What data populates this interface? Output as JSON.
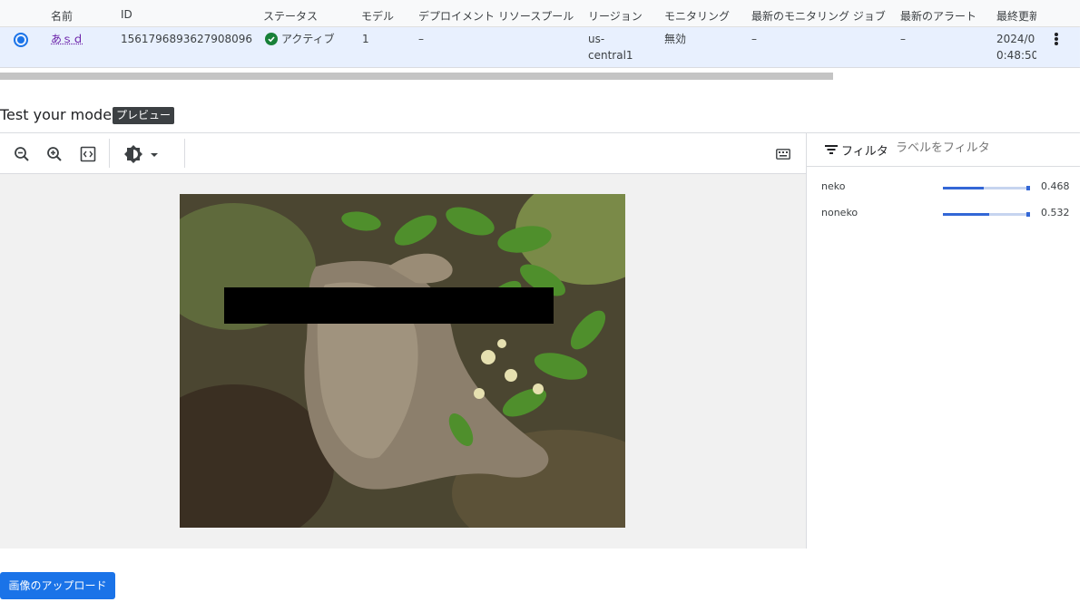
{
  "table": {
    "headers": [
      "名前",
      "ID",
      "ステータス",
      "モデル",
      "デプロイメント リソースプール",
      "リージョン",
      "モニタリング",
      "最新のモニタリング ジョブ",
      "最新のアラート",
      "最終更新"
    ],
    "row": {
      "name": "あｓｄ",
      "id": "1561796893627908096",
      "status": "アクティブ",
      "models": "1",
      "resource_pool": "–",
      "region_line1": "us-",
      "region_line2": "central1",
      "monitoring": "無効",
      "latest_monitoring_job": "–",
      "latest_alert": "–",
      "updated_line1": "2024/0",
      "updated_line2": "0:48:50"
    }
  },
  "test": {
    "title": "Test your model",
    "badge": "プレビュー"
  },
  "toolbar": {
    "icons": [
      "zoom-out-icon",
      "zoom-in-icon",
      "code-icon",
      "brightness-icon",
      "keyboard-icon"
    ]
  },
  "filter": {
    "label": "フィルタ",
    "placeholder": "ラベルをフィルタ"
  },
  "predictions": [
    {
      "label": "neko",
      "score": "0.468",
      "fraction": 0.468
    },
    {
      "label": "noneko",
      "score": "0.532",
      "fraction": 0.532
    }
  ],
  "upload_button": "画像のアップロード",
  "colors": {
    "accent": "#1a73e8",
    "selected_row": "#e8f0fe",
    "active_status": "#188038",
    "bar": "#3367d6"
  }
}
